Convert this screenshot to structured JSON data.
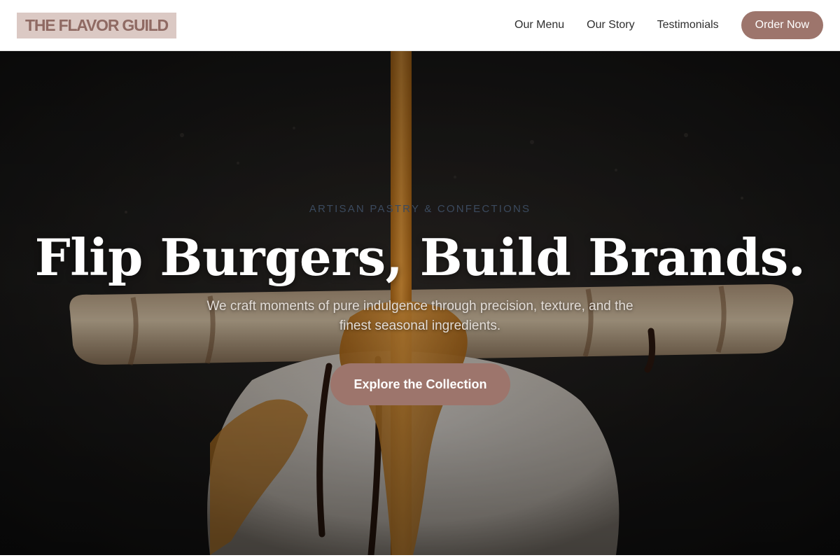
{
  "brand": {
    "logo_text": "THE FLAVOR GUILD"
  },
  "nav": {
    "items": [
      {
        "label": "Our Menu"
      },
      {
        "label": "Our Story"
      },
      {
        "label": "Testimonials"
      }
    ],
    "cta_label": "Order Now"
  },
  "hero": {
    "eyebrow": "ARTISAN PASTRY & CONFECTIONS",
    "headline": "Flip Burgers, Build Brands.",
    "subtitle": "We craft moments of pure indulgence through precision, texture, and the finest seasonal ingredients.",
    "cta_label": "Explore the Collection",
    "image_description_icon": "dessert-photo"
  },
  "colors": {
    "accent": "#9d756c",
    "logo_bg": "#dbc9c4",
    "logo_text": "#8f6a63",
    "hero_bg": "#131313"
  }
}
